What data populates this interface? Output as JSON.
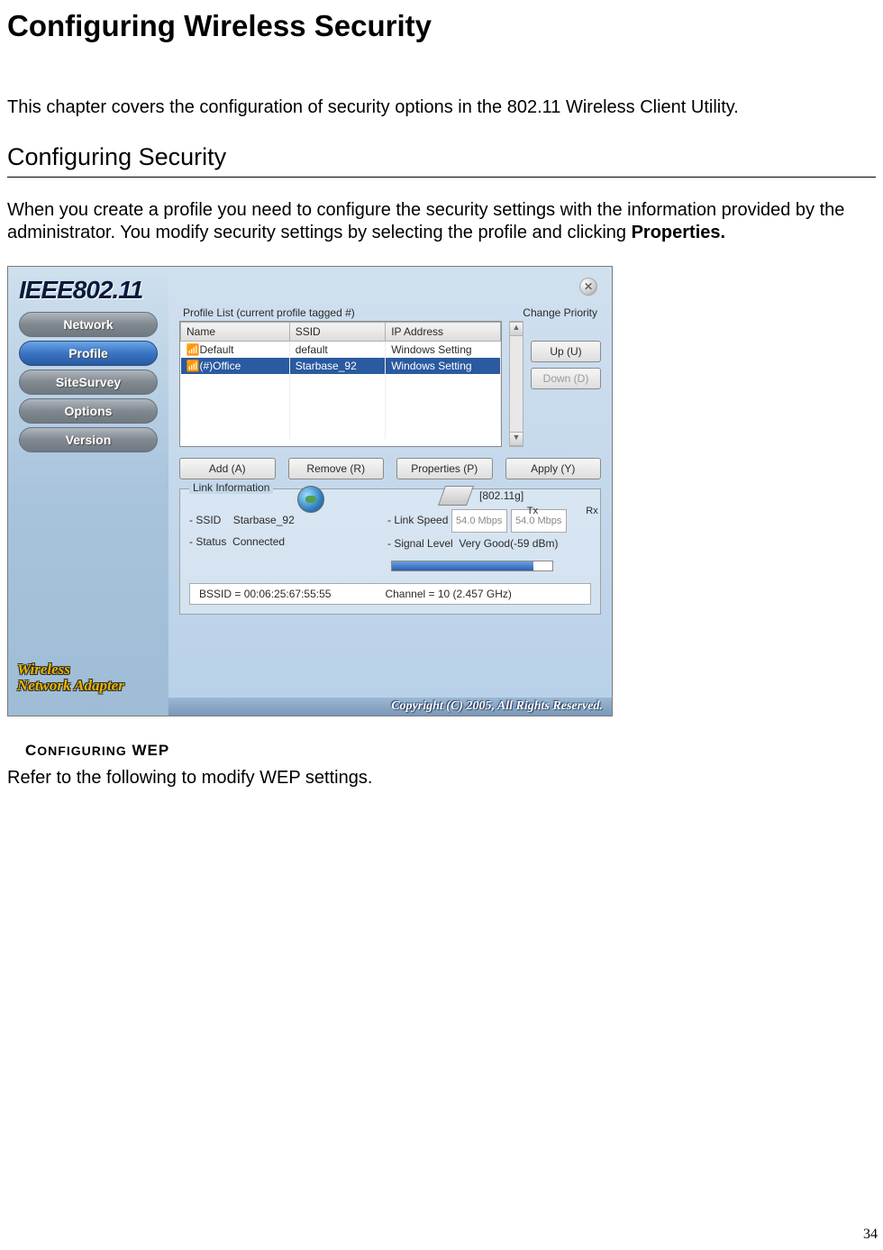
{
  "title": "Configuring Wireless Security",
  "intro": "This chapter covers the configuration of security options in the 802.11 Wireless Client Utility.",
  "section_heading": "Configuring Security",
  "body_para_prefix": "When you create a profile you need to configure the security settings with the information provided by the administrator. You modify security settings by selecting the profile and clicking ",
  "body_para_bold": "Properties.",
  "subhead_prefix_big": "C",
  "subhead_prefix_sc": "ONFIGURING",
  "subhead_wep_big": " WEP",
  "wep_body": "Refer to the following to modify WEP settings.",
  "page_number": "34",
  "screenshot": {
    "logo": "IEEE802.11",
    "nav": [
      "Network",
      "Profile",
      "SiteSurvey",
      "Options",
      "Version"
    ],
    "nav_active_index": 1,
    "adapter_label_l1": "Wireless",
    "adapter_label_l2": "Network Adapter",
    "close_glyph": "✕",
    "profile_list_label": "Profile List (current profile tagged #)",
    "change_priority_label": "Change Priority",
    "columns": [
      "Name",
      "SSID",
      "IP Address"
    ],
    "rows": [
      {
        "name": "Default",
        "ssid": "default",
        "ip": "Windows Setting",
        "selected": false,
        "icon": "📶"
      },
      {
        "name": "(#)Office",
        "ssid": "Starbase_92",
        "ip": "Windows Setting",
        "selected": true,
        "icon": "📶"
      }
    ],
    "up_btn": "Up (U)",
    "down_btn": "Down (D)",
    "actions": {
      "add": "Add (A)",
      "remove": "Remove (R)",
      "properties": "Properties (P)",
      "apply": "Apply (Y)"
    },
    "link_info_label": "Link Information",
    "protocol": "[802.11g]",
    "tx_label": "Tx",
    "rx_label": "Rx",
    "ssid_label": "- SSID",
    "ssid_value": "Starbase_92",
    "status_label": "- Status",
    "status_value": "Connected",
    "speed_label": "- Link Speed",
    "speed_tx": "54.0 Mbps",
    "speed_rx": "54.0 Mbps",
    "signal_label": "- Signal Level",
    "signal_value": "Very Good(-59 dBm)",
    "bssid_label": "BSSID = 00:06:25:67:55:55",
    "channel_label": "Channel = 10 (2.457 GHz)",
    "copyright": "Copyright (C) 2005, All Rights Reserved."
  }
}
